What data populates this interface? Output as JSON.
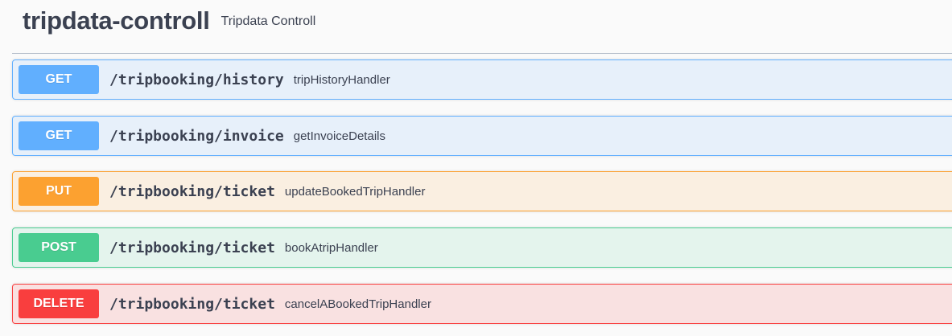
{
  "tag": {
    "name": "tripdata-controll",
    "description": "Tripdata Controll"
  },
  "operations": [
    {
      "method": "GET",
      "path": "/tripbooking/history",
      "summary": "tripHistoryHandler",
      "color": "#61affe"
    },
    {
      "method": "GET",
      "path": "/tripbooking/invoice",
      "summary": "getInvoiceDetails",
      "color": "#61affe"
    },
    {
      "method": "PUT",
      "path": "/tripbooking/ticket",
      "summary": "updateBookedTripHandler",
      "color": "#fca130"
    },
    {
      "method": "POST",
      "path": "/tripbooking/ticket",
      "summary": "bookAtripHandler",
      "color": "#49cc90"
    },
    {
      "method": "DELETE",
      "path": "/tripbooking/ticket",
      "summary": "cancelABookedTripHandler",
      "color": "#f93e3e"
    }
  ]
}
